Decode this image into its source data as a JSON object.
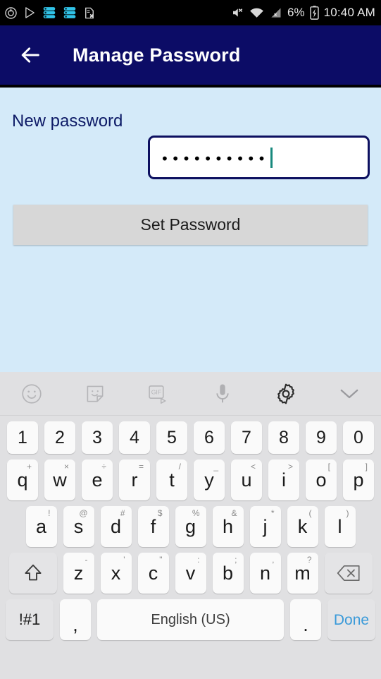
{
  "statusbar": {
    "time": "10:40 AM",
    "battery_percent": "6%",
    "icons_left": [
      "power-circle-icon",
      "play-store-icon",
      "task-list-icon",
      "task-list-icon",
      "document-error-icon"
    ],
    "icons_right": [
      "mute-icon",
      "wifi-icon",
      "no-signal-icon",
      "battery-charging-icon"
    ]
  },
  "appbar": {
    "back_icon": "back-arrow-icon",
    "title": "Manage Password",
    "bg_color": "#0c0c66"
  },
  "content": {
    "bg_color": "#d4eaf9",
    "label": "New password",
    "password_field": {
      "masked_value": "••••••••••",
      "char_count": 10,
      "placeholder": "",
      "caret_color": "#18897d",
      "border_color": "#0d1060"
    },
    "set_button": {
      "label": "Set Password",
      "bg_color": "#d7d7d7"
    }
  },
  "keyboard": {
    "toolbar": [
      {
        "name": "emoji-icon"
      },
      {
        "name": "sticker-icon"
      },
      {
        "name": "gif-icon",
        "label": "GIF"
      },
      {
        "name": "microphone-icon"
      },
      {
        "name": "settings-gear-icon"
      },
      {
        "name": "chevron-down-icon"
      }
    ],
    "rows": {
      "numbers": [
        {
          "main": "1"
        },
        {
          "main": "2"
        },
        {
          "main": "3"
        },
        {
          "main": "4"
        },
        {
          "main": "5"
        },
        {
          "main": "6"
        },
        {
          "main": "7"
        },
        {
          "main": "8"
        },
        {
          "main": "9"
        },
        {
          "main": "0"
        }
      ],
      "top": [
        {
          "main": "q",
          "sup": "+"
        },
        {
          "main": "w",
          "sup": "×"
        },
        {
          "main": "e",
          "sup": "÷"
        },
        {
          "main": "r",
          "sup": "="
        },
        {
          "main": "t",
          "sup": "/"
        },
        {
          "main": "y",
          "sup": "_"
        },
        {
          "main": "u",
          "sup": "<"
        },
        {
          "main": "i",
          "sup": ">"
        },
        {
          "main": "o",
          "sup": "["
        },
        {
          "main": "p",
          "sup": "]"
        }
      ],
      "home": [
        {
          "main": "a",
          "sup": "!"
        },
        {
          "main": "s",
          "sup": "@"
        },
        {
          "main": "d",
          "sup": "#"
        },
        {
          "main": "f",
          "sup": "$"
        },
        {
          "main": "g",
          "sup": "%"
        },
        {
          "main": "h",
          "sup": "&"
        },
        {
          "main": "j",
          "sup": "*"
        },
        {
          "main": "k",
          "sup": "("
        },
        {
          "main": "l",
          "sup": ")"
        }
      ],
      "bottom": [
        {
          "main": "z",
          "sup": "-"
        },
        {
          "main": "x",
          "sup": "'"
        },
        {
          "main": "c",
          "sup": "\""
        },
        {
          "main": "v",
          "sup": ":"
        },
        {
          "main": "b",
          "sup": ";"
        },
        {
          "main": "n",
          "sup": ","
        },
        {
          "main": "m",
          "sup": "?"
        }
      ],
      "shift_icon": "shift-arrow-icon",
      "backspace_icon": "backspace-icon",
      "symbols_label": "!#1",
      "comma_label": ",",
      "space_label": "English (US)",
      "period_label": ".",
      "done_label": "Done",
      "done_color": "#3a9ad9"
    }
  }
}
